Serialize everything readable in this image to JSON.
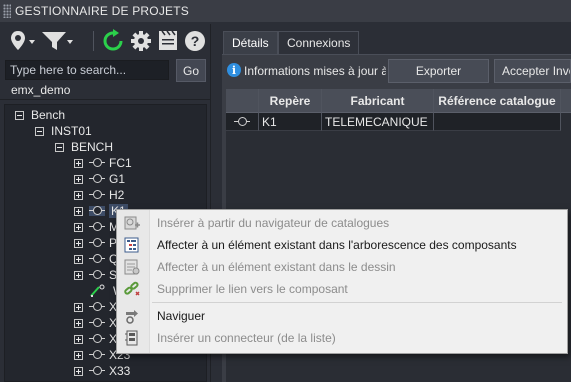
{
  "app": {
    "title": "GESTIONNAIRE DE PROJETS"
  },
  "toolbar": {
    "icons": [
      "location-pin-icon",
      "filter-icon",
      "refresh-icon",
      "gear-icon",
      "clapperboard-icon",
      "help-icon"
    ],
    "colors": {
      "refresh": "#2bd04b",
      "icon": "#e0e0e0"
    }
  },
  "search": {
    "placeholder": "Type here to search...",
    "value": "",
    "go_label": "Go"
  },
  "project": {
    "name": "emx_demo"
  },
  "tree": {
    "root": "Bench",
    "installation": "INST01",
    "location": "BENCH",
    "components": [
      {
        "label": "FC1"
      },
      {
        "label": "G1"
      },
      {
        "label": "H2"
      },
      {
        "label": "K1",
        "selected": true
      },
      {
        "label": "M"
      },
      {
        "label": "P"
      },
      {
        "label": "Q"
      },
      {
        "label": "S"
      },
      {
        "label": "W",
        "icon": "wire-icon"
      },
      {
        "label": "X"
      },
      {
        "label": "X"
      },
      {
        "label": "X"
      },
      {
        "label": "X23"
      },
      {
        "label": "X33"
      }
    ]
  },
  "tabs": [
    {
      "label": "Détails",
      "active": true
    },
    {
      "label": "Connexions",
      "active": false
    }
  ],
  "details": {
    "info_text": "Informations mises à jour à",
    "export_label": "Exporter",
    "accept_label": "Accepter Inve"
  },
  "grid": {
    "columns": [
      "Repère",
      "Fabricant",
      "Référence catalogue"
    ],
    "rows": [
      {
        "repere": "K1",
        "fabricant": "TELEMECANIQUE",
        "reference": ""
      }
    ]
  },
  "context_menu": {
    "items": [
      {
        "label": "Insérer à partir du navigateur de catalogues",
        "enabled": false,
        "icon": "catalog-insert-icon"
      },
      {
        "label": "Affecter à un élément existant dans l'arborescence des composants",
        "enabled": true,
        "icon": "assign-tree-icon"
      },
      {
        "label": "Affecter à un élément existant dans le dessin",
        "enabled": false,
        "icon": "assign-drawing-icon"
      },
      {
        "label": "Supprimer le lien vers le composant",
        "enabled": false,
        "icon": "unlink-icon"
      },
      {
        "label": "Naviguer",
        "enabled": true,
        "icon": "navigate-icon"
      },
      {
        "label": "Insérer un connecteur (de la liste)",
        "enabled": false,
        "icon": "connector-icon"
      }
    ]
  }
}
